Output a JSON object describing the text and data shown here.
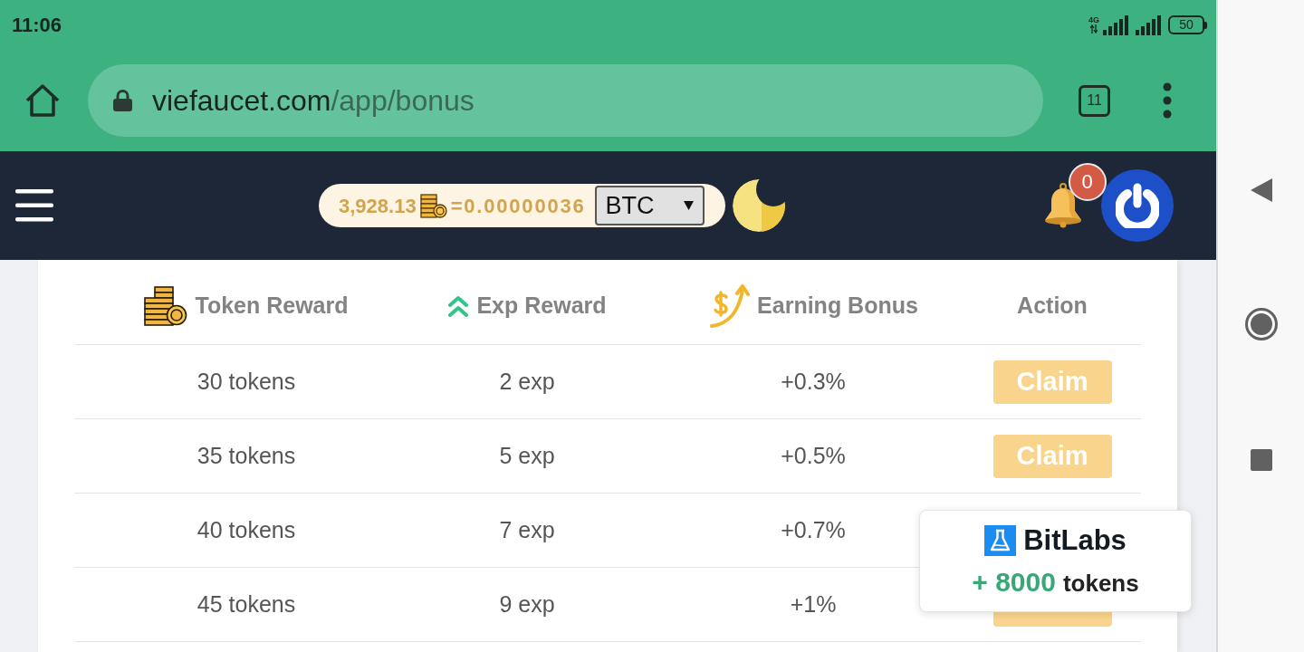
{
  "status_bar": {
    "time": "11:06",
    "network": "4G",
    "battery": "50"
  },
  "browser": {
    "url_host": "viefaucet.com",
    "url_path": "/app/bonus",
    "tab_count": "11"
  },
  "app_bar": {
    "balance": "3,928.13",
    "rate": "=0.00000036",
    "currency": "BTC",
    "notifications": "0"
  },
  "table": {
    "columns": [
      "Token Reward",
      "Exp Reward",
      "Earning Bonus",
      "Action"
    ],
    "rows": [
      {
        "tokens": "30 tokens",
        "exp": "2 exp",
        "bonus": "+0.3%",
        "action": {
          "kind": "button",
          "label": "Claim"
        }
      },
      {
        "tokens": "35 tokens",
        "exp": "5 exp",
        "bonus": "+0.5%",
        "action": {
          "kind": "button",
          "label": "Claim"
        }
      },
      {
        "tokens": "40 tokens",
        "exp": "7 exp",
        "bonus": "+0.7%"
      },
      {
        "tokens": "45 tokens",
        "exp": "9 exp",
        "bonus": "+1%",
        "action": {
          "kind": "button"
        }
      }
    ]
  },
  "popup": {
    "brand": "BitLabs",
    "amount": "+ 8000",
    "unit": "tokens"
  }
}
